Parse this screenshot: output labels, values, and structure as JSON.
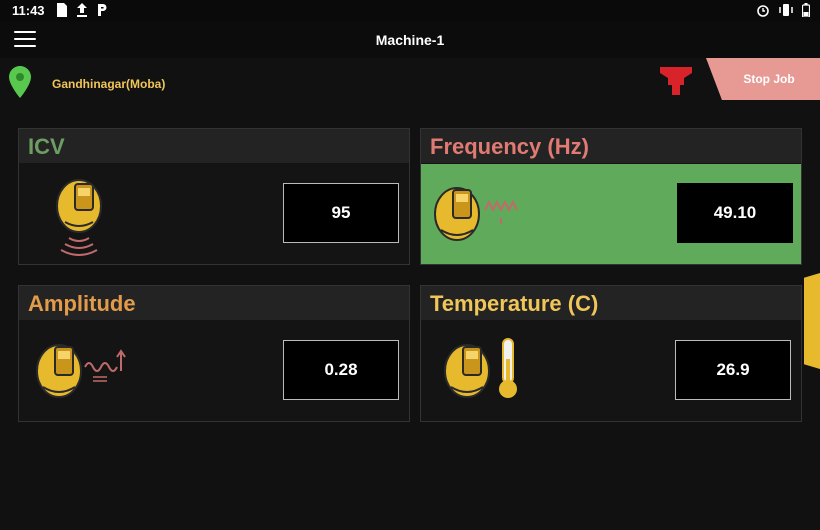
{
  "status_bar": {
    "time": "11:43"
  },
  "app_bar": {
    "title": "Machine-1"
  },
  "location": {
    "name": "Gandhinagar(Moba)"
  },
  "actions": {
    "stop_job_label": "Stop Job"
  },
  "colors": {
    "icv_title": "#6e9d64",
    "frequency_title": "#e07a73",
    "amplitude_title": "#e29a4b",
    "temperature_title": "#f0c659",
    "highlight": "#60ab5b",
    "stop_job": "#e79a93",
    "icon_yellow": "#e7b92d"
  },
  "cards": {
    "icv": {
      "title": "ICV",
      "value": "95",
      "icon": "roller-signal-icon"
    },
    "frequency": {
      "title": "Frequency (Hz)",
      "value": "49.10",
      "icon": "roller-wave-icon",
      "highlighted": true
    },
    "amplitude": {
      "title": "Amplitude",
      "value": "0.28",
      "icon": "roller-amplitude-icon"
    },
    "temperature": {
      "title": "Temperature (C)",
      "value": "26.9",
      "icon": "roller-thermometer-icon"
    }
  }
}
